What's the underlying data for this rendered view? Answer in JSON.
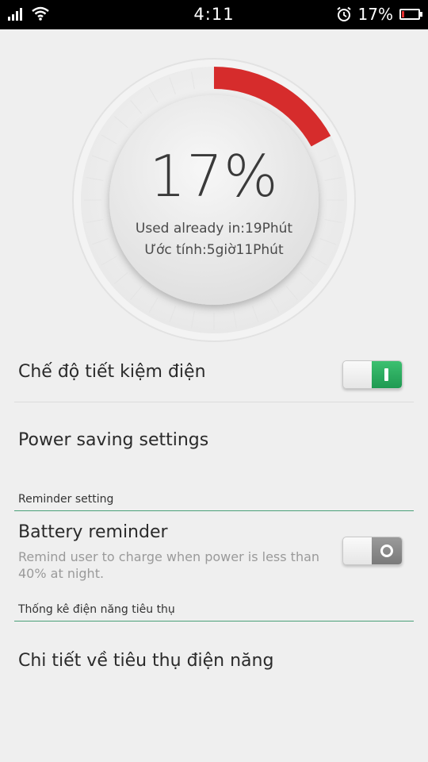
{
  "status_bar": {
    "time": "4:11",
    "battery_text": "17%",
    "battery_level": 0.17,
    "icons": [
      "signal-icon",
      "wifi-icon",
      "alarm-icon",
      "battery-icon"
    ]
  },
  "gauge": {
    "percent_text": "17%",
    "level": 0.17,
    "used_text": "Used already in:19Phút",
    "estimate_text": "Ước tính:5giờ11Phút",
    "accent_color": "#d62c2c"
  },
  "power_saving_mode": {
    "label": "Chế độ tiết kiệm điện",
    "enabled": true
  },
  "power_saving_settings": {
    "label": "Power saving settings"
  },
  "reminder_section": {
    "header": "Reminder setting",
    "battery_reminder": {
      "label": "Battery reminder",
      "description": "Remind user to charge when power is less than 40% at night.",
      "enabled": false
    }
  },
  "stats_section": {
    "header": "Thống kê điện năng tiêu thụ",
    "details_label": "Chi tiết về tiêu thụ điện năng"
  },
  "colors": {
    "section_line": "#4aa079",
    "toggle_on": "#2aad5f",
    "toggle_off": "#8a8a8a"
  }
}
